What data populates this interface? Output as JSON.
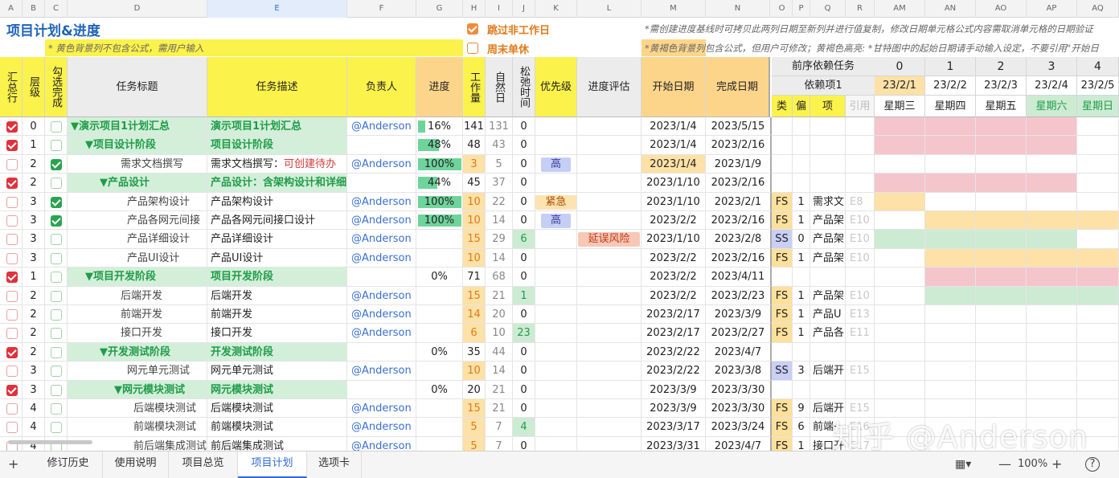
{
  "columns": [
    "A",
    "B",
    "C",
    "D",
    "E",
    "F",
    "G",
    "H",
    "I",
    "J",
    "K",
    "L",
    "M",
    "N",
    "O",
    "P",
    "Q",
    "R",
    "AM",
    "AN",
    "AO",
    "AP",
    "AQ"
  ],
  "title": "项目计划&进度",
  "notes": {
    "yellow_input": "* 黄色背景列不包含公式，需用户输入",
    "top_right": "*需创建进度基线时可拷贝此两列日期至新列并进行值复制，修改日期单元格公式内容需取消单元格的日期验证",
    "second_right": "*黄褐色背景列包含公式，但用户可修改；黄褐色高亮: *甘特图中的起始日期请手动输入设定，不要引用\"开始日"
  },
  "options": {
    "skip_nonwork": "跳过非工作日",
    "weekend_single": "周末单休"
  },
  "headers": {
    "summary": "汇总行",
    "level": "层级",
    "done": "勾选完成",
    "task_title": "任务标题",
    "task_desc": "任务描述",
    "owner": "负责人",
    "progress": "进度",
    "workload": "工作量",
    "natural_days": "自然日",
    "slack": "松弛时间",
    "priority": "优先级",
    "assess": "进度评估",
    "start": "开始日期",
    "end": "完成日期",
    "predecessor": "前序依赖任务",
    "dep1": "依赖项1",
    "type": "类",
    "offset": "偏",
    "item": "项",
    "ref": "引用"
  },
  "gantt": {
    "indexes": [
      "0",
      "1",
      "2",
      "3",
      "4"
    ],
    "dates": [
      "23/2/1",
      "23/2/2",
      "23/2/3",
      "23/2/4",
      "23/2/5"
    ],
    "weekdays": [
      "星期三",
      "星期四",
      "星期五",
      "星期六",
      "星期日"
    ]
  },
  "rows": [
    {
      "sum": true,
      "lvl": "0",
      "chk": false,
      "title": "▼演示项目1计划汇总",
      "desc": "演示项目1计划汇总",
      "owner": "@Anderson",
      "prog": "16%",
      "pv": 0.16,
      "wl": "141",
      "nd": "131",
      "sl": "0",
      "pri": "",
      "asmt": "",
      "start": "2023/1/4",
      "end": "2023/5/15",
      "t": "",
      "o": "",
      "it": "",
      "ref": "",
      "g": "pppp",
      "indent": 0,
      "isSum": true
    },
    {
      "sum": true,
      "lvl": "1",
      "chk": false,
      "title": "▼项目设计阶段",
      "desc": "项目设计阶段",
      "owner": "",
      "prog": "48%",
      "pv": 0.48,
      "wl": "48",
      "nd": "43",
      "sl": "0",
      "pri": "",
      "asmt": "",
      "start": "2023/1/4",
      "end": "2023/2/16",
      "t": "",
      "o": "",
      "it": "",
      "ref": "",
      "g": "pppp",
      "indent": 1,
      "isSum": true
    },
    {
      "sum": false,
      "lvl": "2",
      "chk": true,
      "title": "需求文档撰写",
      "desc": "需求文档撰写：",
      "descExtra": "可创建待办",
      "owner": "@Anderson",
      "prog": "100%",
      "pv": 1,
      "wl": "3",
      "nd": "5",
      "sl": "0",
      "pri": "高",
      "asmt": "",
      "start": "2023/1/4",
      "end": "2023/1/9",
      "t": "",
      "o": "",
      "it": "",
      "ref": "",
      "g": "",
      "indent": 2,
      "isSum": false,
      "startOrg": true
    },
    {
      "sum": true,
      "lvl": "2",
      "chk": false,
      "title": "▼产品设计",
      "desc": "产品设计：含架构设计和详细设计",
      "owner": "",
      "prog": "44%",
      "pv": 0.44,
      "wl": "45",
      "nd": "37",
      "sl": "0",
      "pri": "",
      "asmt": "",
      "start": "2023/1/10",
      "end": "2023/2/16",
      "t": "",
      "o": "",
      "it": "",
      "ref": "",
      "g": "pppp",
      "indent": 2,
      "isSum": true
    },
    {
      "sum": false,
      "lvl": "3",
      "chk": true,
      "title": "产品架构设计",
      "desc": "产品架构设计",
      "owner": "@Anderson",
      "prog": "100%",
      "pv": 1,
      "wl": "10",
      "nd": "22",
      "sl": "0",
      "pri": "紧急",
      "asmt": "",
      "start": "2023/1/10",
      "end": "2023/2/1",
      "t": "FS",
      "o": "1",
      "it": "需求文",
      "ref": "E8",
      "g": "o",
      "indent": 3,
      "isSum": false
    },
    {
      "sum": false,
      "lvl": "3",
      "chk": true,
      "title": "产品各网元间接",
      "desc": "产品各网元间接口设计",
      "owner": "@Anderson",
      "prog": "100%",
      "pv": 1,
      "wl": "10",
      "nd": "14",
      "sl": "0",
      "pri": "高",
      "asmt": "",
      "start": "2023/2/2",
      "end": "2023/2/16",
      "t": "FS",
      "o": "1",
      "it": "产品架",
      "ref": "E10",
      "g": "_oooo",
      "indent": 3,
      "isSum": false
    },
    {
      "sum": false,
      "lvl": "3",
      "chk": false,
      "title": "产品详细设计",
      "desc": "产品详细设计",
      "owner": "@Anderson",
      "prog": "",
      "pv": 0,
      "wl": "15",
      "nd": "29",
      "sl": "6",
      "pri": "",
      "asmt": "延误风险",
      "start": "2023/1/10",
      "end": "2023/2/8",
      "t": "SS",
      "o": "0",
      "it": "产品架",
      "ref": "E10",
      "g": "gggg",
      "indent": 3,
      "isSum": false
    },
    {
      "sum": false,
      "lvl": "3",
      "chk": false,
      "title": "产品UI设计",
      "desc": "产品UI设计",
      "owner": "@Anderson",
      "prog": "",
      "pv": 0,
      "wl": "10",
      "nd": "14",
      "sl": "0",
      "pri": "",
      "asmt": "",
      "start": "2023/2/2",
      "end": "2023/2/16",
      "t": "FS",
      "o": "1",
      "it": "产品架",
      "ref": "E10",
      "g": "_oooo",
      "indent": 3,
      "isSum": false
    },
    {
      "sum": true,
      "lvl": "1",
      "chk": false,
      "title": "▼项目开发阶段",
      "desc": "项目开发阶段",
      "owner": "",
      "prog": "0%",
      "pv": 0,
      "wl": "71",
      "nd": "68",
      "sl": "0",
      "pri": "",
      "asmt": "",
      "start": "2023/2/2",
      "end": "2023/4/11",
      "t": "",
      "o": "",
      "it": "",
      "ref": "",
      "g": "_pppp",
      "indent": 1,
      "isSum": true
    },
    {
      "sum": false,
      "lvl": "2",
      "chk": false,
      "title": "后端开发",
      "desc": "后端开发",
      "owner": "@Anderson",
      "prog": "",
      "pv": 0,
      "wl": "15",
      "nd": "21",
      "sl": "1",
      "pri": "",
      "asmt": "",
      "start": "2023/2/2",
      "end": "2023/2/23",
      "t": "FS",
      "o": "1",
      "it": "产品架",
      "ref": "E10",
      "g": "_gggg",
      "indent": 2,
      "isSum": false
    },
    {
      "sum": false,
      "lvl": "2",
      "chk": false,
      "title": "前端开发",
      "desc": "前端开发",
      "owner": "@Anderson",
      "prog": "",
      "pv": 0,
      "wl": "14",
      "nd": "20",
      "sl": "0",
      "pri": "",
      "asmt": "",
      "start": "2023/2/17",
      "end": "2023/3/9",
      "t": "FS",
      "o": "1",
      "it": "产品U",
      "ref": "E13",
      "g": "",
      "indent": 2,
      "isSum": false
    },
    {
      "sum": false,
      "lvl": "2",
      "chk": false,
      "title": "接口开发",
      "desc": "接口开发",
      "owner": "@Anderson",
      "prog": "",
      "pv": 0,
      "wl": "6",
      "nd": "10",
      "sl": "23",
      "pri": "",
      "asmt": "",
      "start": "2023/2/17",
      "end": "2023/2/27",
      "t": "FS",
      "o": "1",
      "it": "产品各",
      "ref": "E11",
      "g": "",
      "indent": 2,
      "isSum": false
    },
    {
      "sum": true,
      "lvl": "2",
      "chk": false,
      "title": "▼开发测试阶段",
      "desc": "开发测试阶段",
      "owner": "",
      "prog": "0%",
      "pv": 0,
      "wl": "35",
      "nd": "44",
      "sl": "0",
      "pri": "",
      "asmt": "",
      "start": "2023/2/22",
      "end": "2023/4/7",
      "t": "",
      "o": "",
      "it": "",
      "ref": "",
      "g": "",
      "indent": 2,
      "isSum": true
    },
    {
      "sum": false,
      "lvl": "3",
      "chk": false,
      "title": "网元单元测试",
      "desc": "网元单元测试",
      "owner": "@Anderson",
      "prog": "",
      "pv": 0,
      "wl": "10",
      "nd": "14",
      "sl": "0",
      "pri": "",
      "asmt": "",
      "start": "2023/2/22",
      "end": "2023/3/8",
      "t": "SS",
      "o": "3",
      "it": "后端开",
      "ref": "E15",
      "g": "",
      "indent": 3,
      "isSum": false
    },
    {
      "sum": true,
      "lvl": "3",
      "chk": false,
      "title": "▼网元模块测试",
      "desc": "网元模块测试",
      "owner": "",
      "prog": "0%",
      "pv": 0,
      "wl": "20",
      "nd": "21",
      "sl": "0",
      "pri": "",
      "asmt": "",
      "start": "2023/3/9",
      "end": "2023/3/30",
      "t": "",
      "o": "",
      "it": "",
      "ref": "",
      "g": "",
      "indent": 3,
      "isSum": true
    },
    {
      "sum": false,
      "lvl": "4",
      "chk": false,
      "title": "后端模块测试",
      "desc": "后端模块测试",
      "owner": "@Anderson",
      "prog": "",
      "pv": 0,
      "wl": "15",
      "nd": "21",
      "sl": "0",
      "pri": "",
      "asmt": "",
      "start": "2023/3/9",
      "end": "2023/3/30",
      "t": "FS",
      "o": "9",
      "it": "后端开",
      "ref": "E15",
      "g": "",
      "indent": 4,
      "isSum": false
    },
    {
      "sum": false,
      "lvl": "4",
      "chk": false,
      "title": "前端模块测试",
      "desc": "前端模块测试",
      "owner": "@Anderson",
      "prog": "",
      "pv": 0,
      "wl": "5",
      "nd": "7",
      "sl": "4",
      "pri": "",
      "asmt": "",
      "start": "2023/3/17",
      "end": "2023/3/24",
      "t": "FS",
      "o": "6",
      "it": "前端ᅩ",
      "ref": "E16",
      "g": "",
      "indent": 4,
      "isSum": false
    },
    {
      "sum": false,
      "lvl": "4",
      "chk": false,
      "title": "前后端集成测试",
      "desc": "前后端集成测试",
      "owner": "@Anderson",
      "prog": "",
      "pv": 0,
      "wl": "5",
      "nd": "7",
      "sl": "0",
      "pri": "",
      "asmt": "",
      "start": "2023/3/31",
      "end": "2023/4/7",
      "t": "FS",
      "o": "1",
      "it": "接口开",
      "ref": "E17",
      "g": "",
      "indent": 4,
      "isSum": false
    }
  ],
  "watermark": "知乎 @Anderson",
  "tabs": [
    "修订历史",
    "使用说明",
    "项目总览",
    "项目计划",
    "选项卡"
  ],
  "active_tab": "项目计划",
  "zoom": "100%",
  "status_icons": [
    "add-sheet-icon",
    "view-mode-icon",
    "zoom-out-icon",
    "zoom-in-icon",
    "help-icon"
  ]
}
